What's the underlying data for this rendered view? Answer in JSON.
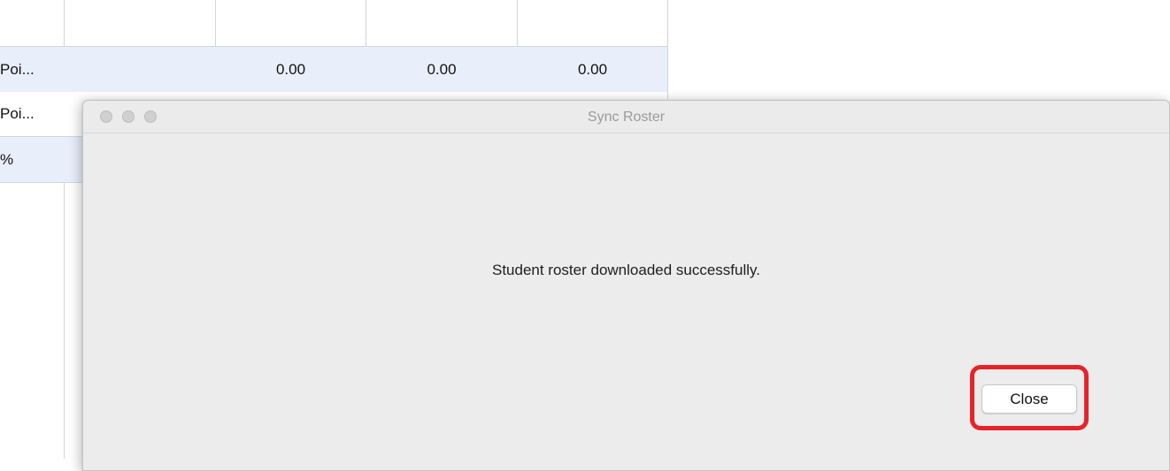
{
  "spreadsheet": {
    "rows": [
      {
        "label": "Poi...",
        "values": [
          "",
          "0.00",
          "0.00",
          "0.00"
        ]
      },
      {
        "label": "Poi...",
        "values": [
          "",
          "",
          "",
          ""
        ]
      },
      {
        "label": "%",
        "values": [
          "",
          "",
          "",
          ""
        ]
      }
    ]
  },
  "dialog": {
    "title": "Sync Roster",
    "message": "Student roster downloaded successfully.",
    "close_label": "Close",
    "highlight_color": "#e8222a"
  }
}
